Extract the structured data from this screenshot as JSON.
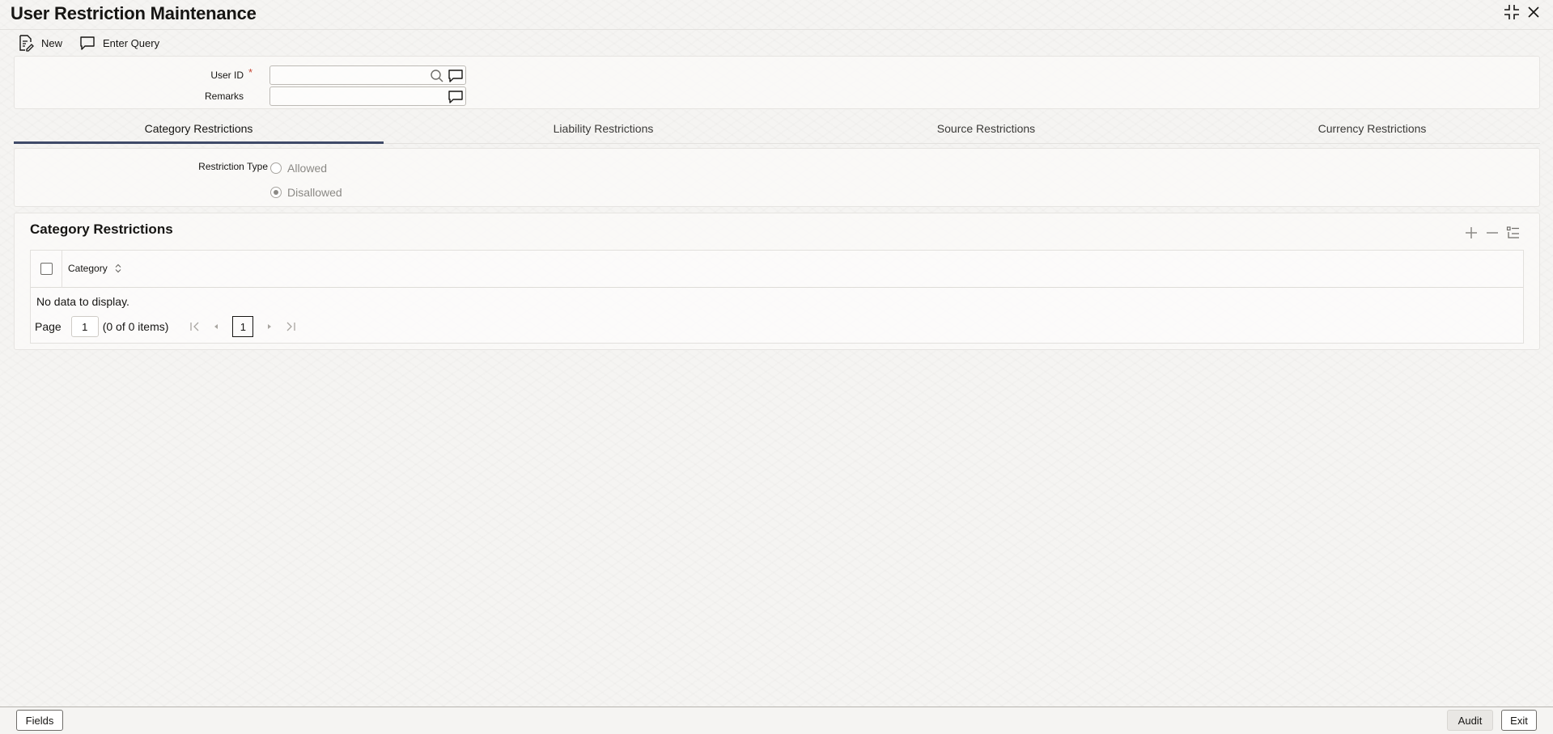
{
  "window": {
    "title": "User Restriction Maintenance"
  },
  "toolbar": {
    "new_label": "New",
    "enter_query_label": "Enter Query"
  },
  "form": {
    "user_id_label": "User ID",
    "required_mark": "*",
    "user_id_value": "",
    "remarks_label": "Remarks",
    "remarks_value": ""
  },
  "tabs": [
    {
      "label": "Category Restrictions",
      "active": true
    },
    {
      "label": "Liability Restrictions",
      "active": false
    },
    {
      "label": "Source Restrictions",
      "active": false
    },
    {
      "label": "Currency Restrictions",
      "active": false
    }
  ],
  "restriction": {
    "label": "Restriction Type",
    "options": [
      {
        "label": "Allowed",
        "checked": false
      },
      {
        "label": "Disallowed",
        "checked": true
      }
    ]
  },
  "section": {
    "title": "Category Restrictions",
    "table": {
      "columns": [
        "Category"
      ],
      "rows": [],
      "empty_text": "No data to display."
    },
    "pagination": {
      "page_label": "Page",
      "page_value": "1",
      "items_text": "(0 of 0 items)",
      "current_page": "1"
    }
  },
  "footer": {
    "fields_label": "Fields",
    "audit_label": "Audit",
    "exit_label": "Exit"
  }
}
